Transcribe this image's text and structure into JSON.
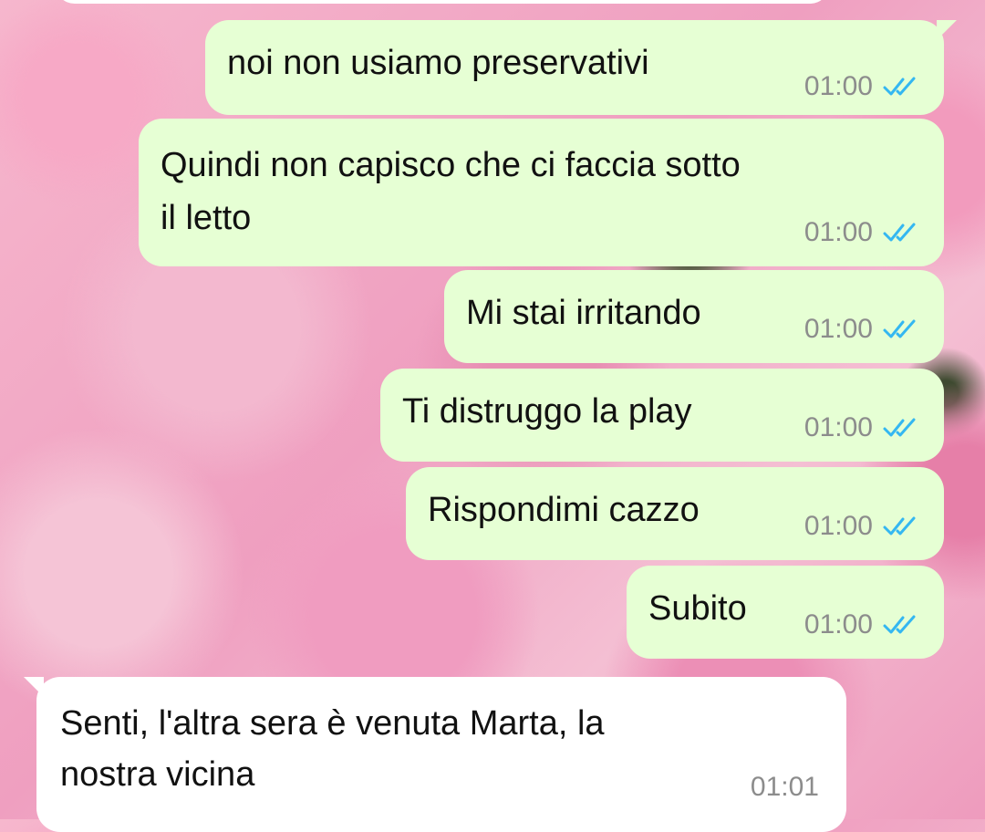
{
  "messages": [
    {
      "direction": "out",
      "text": "noi non usiamo preservativi",
      "time": "01:00",
      "status_icon": "double-check-read-icon"
    },
    {
      "direction": "out",
      "text_lines": [
        "Quindi non capisco che ci faccia sotto",
        "il letto"
      ],
      "time": "01:00",
      "status_icon": "double-check-read-icon"
    },
    {
      "direction": "out",
      "text": "Mi stai irritando",
      "time": "01:00",
      "status_icon": "double-check-read-icon"
    },
    {
      "direction": "out",
      "text": "Ti distruggo la play",
      "time": "01:00",
      "status_icon": "double-check-read-icon"
    },
    {
      "direction": "out",
      "text": "Rispondimi cazzo",
      "time": "01:00",
      "status_icon": "double-check-read-icon"
    },
    {
      "direction": "out",
      "text": "Subito",
      "time": "01:00",
      "status_icon": "double-check-read-icon"
    },
    {
      "direction": "in",
      "text_lines": [
        "Senti, l'altra sera è venuta Marta, la",
        "nostra vicina"
      ],
      "time": "01:01"
    }
  ],
  "colors": {
    "outgoing_bubble": "#e6ffd4",
    "incoming_bubble": "#ffffff",
    "read_ticks": "#34b7f1",
    "timestamp": "#8c8c8c"
  }
}
